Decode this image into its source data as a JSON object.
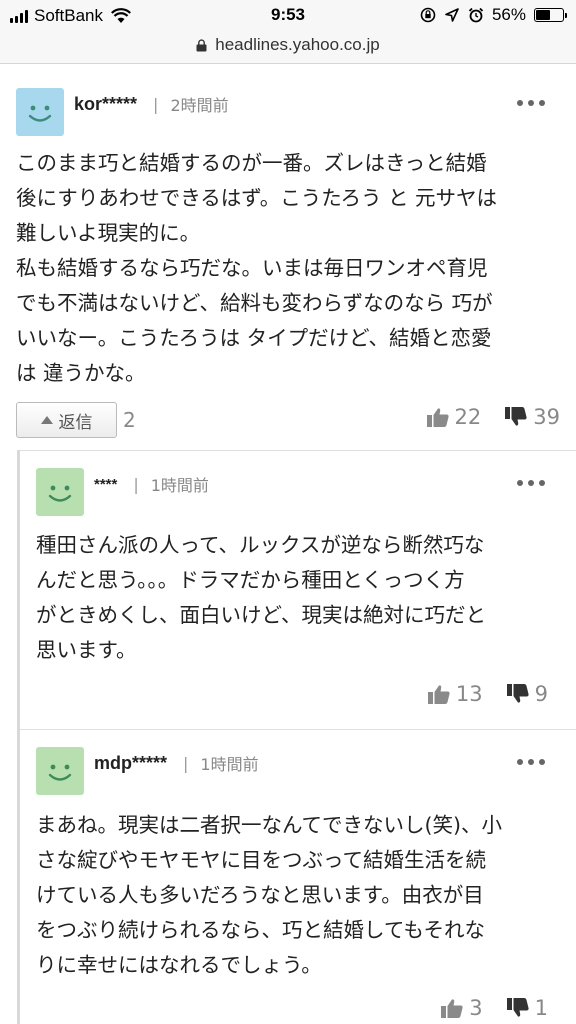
{
  "status_bar": {
    "carrier": "SoftBank",
    "time": "9:53",
    "battery_percent": "56%",
    "battery_level": 0.56,
    "icons": [
      "signal-icon",
      "wifi-icon",
      "rotation-lock-icon",
      "location-icon",
      "alarm-icon",
      "battery-icon"
    ]
  },
  "browser": {
    "url": "headlines.yahoo.co.jp"
  },
  "comments": [
    {
      "user": "kor*****",
      "time_ago": "2時間前",
      "avatar_color": "#a8d8ee",
      "lines": [
        "このまま巧と結婚するのが一番。ズレはきっと結婚",
        "後にすりあわせできるはず。こうたろう と 元サヤは",
        "難しいよ現実的に。",
        "私も結婚するなら巧だな。いまは毎日ワンオペ育児",
        "でも不満はないけど、給料も変わらずなのなら 巧が",
        "いいなー。こうたろうは タイプだけど、結婚と恋愛",
        "は 違うかな。"
      ],
      "reply_label": "返信",
      "reply_count": "2",
      "likes": "22",
      "dislikes": "39"
    },
    {
      "user": "****",
      "time_ago": "1時間前",
      "avatar_color": "#b7dfb0",
      "lines": [
        "種田さん派の人って、ルックスが逆なら断然巧な",
        "んだと思う。。。ドラマだから種田とくっつく方",
        "がときめくし、面白いけど、現実は絶対に巧だと",
        "思います。"
      ],
      "likes": "13",
      "dislikes": "9"
    },
    {
      "user": "mdp*****",
      "time_ago": "1時間前",
      "avatar_color": "#b7dfb0",
      "lines": [
        "まあね。現実は二者択一なんてできないし(笑)、小",
        "さな綻びやモヤモヤに目をつぶって結婚生活を続",
        "けている人も多いだろうなと思います。由衣が目",
        "をつぶり続けられるなら、巧と結婚してもそれな",
        "りに幸せにはなれるでしょう。"
      ],
      "likes": "3",
      "dislikes": "1"
    }
  ]
}
